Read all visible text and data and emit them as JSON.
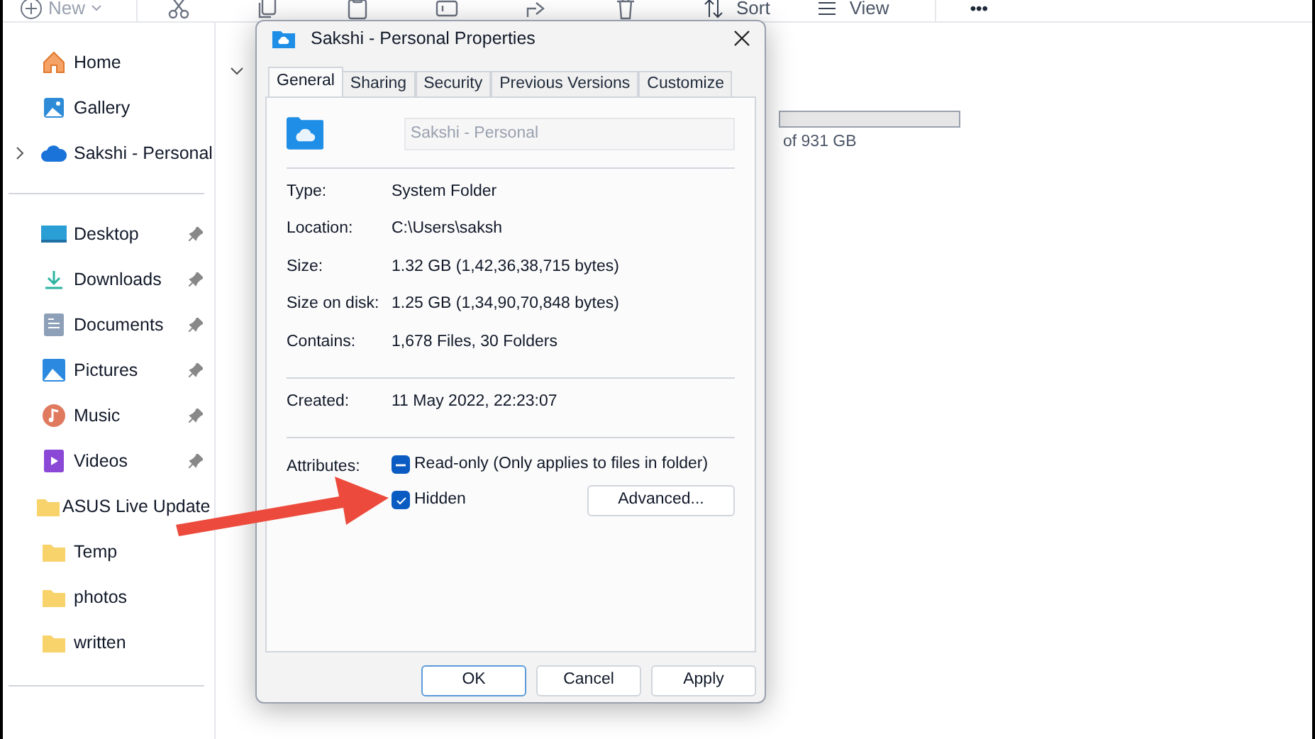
{
  "toolbar": {
    "items": [
      {
        "kind": "new",
        "label": "New"
      },
      {
        "kind": "cut"
      },
      {
        "kind": "copy"
      },
      {
        "kind": "paste"
      },
      {
        "kind": "rename"
      },
      {
        "kind": "share"
      },
      {
        "kind": "delete"
      },
      {
        "kind": "sort",
        "label": "Sort"
      },
      {
        "kind": "view",
        "label": "View"
      },
      {
        "kind": "more",
        "label": "•••"
      }
    ]
  },
  "sidebar": {
    "top": [
      {
        "kind": "home",
        "label": "Home",
        "expandable": false
      },
      {
        "kind": "gallery",
        "label": "Gallery",
        "expandable": false
      },
      {
        "kind": "cloud",
        "label": "Sakshi - Personal",
        "expandable": true
      }
    ],
    "pinned": [
      {
        "kind": "desktop",
        "label": "Desktop",
        "pinned": true
      },
      {
        "kind": "downloads",
        "label": "Downloads",
        "pinned": true
      },
      {
        "kind": "documents",
        "label": "Documents",
        "pinned": true
      },
      {
        "kind": "pictures",
        "label": "Pictures",
        "pinned": true
      },
      {
        "kind": "music",
        "label": "Music",
        "pinned": true
      },
      {
        "kind": "videos",
        "label": "Videos",
        "pinned": true
      },
      {
        "kind": "folder",
        "label": "ASUS Live Update",
        "pinned": false
      },
      {
        "kind": "folder",
        "label": "Temp",
        "pinned": false
      },
      {
        "kind": "folder",
        "label": "photos",
        "pinned": false
      },
      {
        "kind": "folder",
        "label": "written",
        "pinned": false
      }
    ]
  },
  "content": {
    "drive_free_text": "of 931 GB"
  },
  "dialog": {
    "title": "Sakshi - Personal Properties",
    "tabs": [
      {
        "label": "General",
        "selected": true
      },
      {
        "label": "Sharing",
        "selected": false
      },
      {
        "label": "Security",
        "selected": false
      },
      {
        "label": "Previous Versions",
        "selected": false
      },
      {
        "label": "Customize",
        "selected": false
      }
    ],
    "name_field": {
      "value": "Sakshi - Personal",
      "disabled": true
    },
    "groups": [
      [
        {
          "label": "Type:",
          "value": "System Folder"
        },
        {
          "label": "Location:",
          "value": "C:\\Users\\saksh"
        },
        {
          "label": "Size:",
          "value": "1.32 GB (1,42,36,38,715 bytes)"
        },
        {
          "label": "Size on disk:",
          "value": "1.25 GB (1,34,90,70,848 bytes)"
        },
        {
          "label": "Contains:",
          "value": "1,678 Files, 30 Folders"
        }
      ],
      [
        {
          "label": "Created:",
          "value": "11 May 2022, 22:23:07"
        }
      ]
    ],
    "attributes_label": "Attributes:",
    "attributes": [
      {
        "label": "Read-only (Only applies to files in folder)",
        "kind": "mixed"
      },
      {
        "label": "Hidden",
        "kind": "checked"
      }
    ],
    "advanced_button": "Advanced...",
    "buttons": [
      {
        "label": "OK",
        "default": true
      },
      {
        "label": "Cancel",
        "default": false
      },
      {
        "label": "Apply",
        "default": false
      }
    ]
  }
}
